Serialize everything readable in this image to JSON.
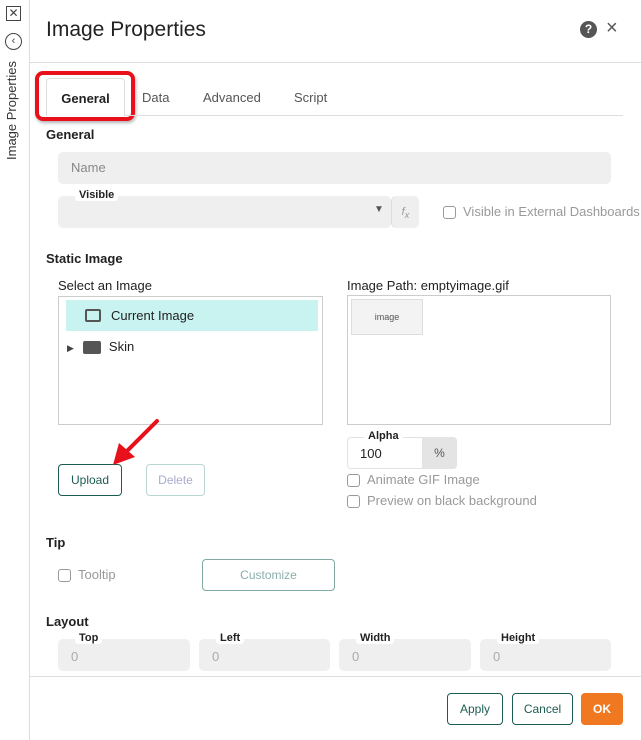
{
  "sidebar": {
    "label": "Image Properties"
  },
  "header": {
    "title": "Image Properties"
  },
  "tabs": [
    {
      "label": "General"
    },
    {
      "label": "Data"
    },
    {
      "label": "Advanced"
    },
    {
      "label": "Script"
    }
  ],
  "general": {
    "heading": "General",
    "name_placeholder": "Name",
    "visible_label": "Visible",
    "visible_value": "",
    "external_label": "Visible in External Dashboards"
  },
  "static_image": {
    "heading": "Static Image",
    "select_label": "Select an Image",
    "tree": [
      {
        "label": "Current Image"
      },
      {
        "label": "Skin"
      }
    ],
    "path_label": "Image Path: emptyimage.gif",
    "preview_text": "image",
    "alpha_label": "Alpha",
    "alpha_value": "100",
    "alpha_unit": "%",
    "animate_label": "Animate GIF Image",
    "black_bg_label": "Preview on black background",
    "upload": "Upload",
    "delete": "Delete"
  },
  "tip": {
    "heading": "Tip",
    "tooltip_label": "Tooltip",
    "customize": "Customize"
  },
  "layout": {
    "heading": "Layout",
    "fields": [
      {
        "label": "Top",
        "value": "0"
      },
      {
        "label": "Left",
        "value": "0"
      },
      {
        "label": "Width",
        "value": "0"
      },
      {
        "label": "Height",
        "value": "0"
      }
    ]
  },
  "footer": {
    "apply": "Apply",
    "cancel": "Cancel",
    "ok": "OK"
  },
  "colors": {
    "accent": "#1d5c52",
    "ok": "#f07820",
    "highlight": "#e8101a",
    "selected_row": "#c9f3f1"
  }
}
